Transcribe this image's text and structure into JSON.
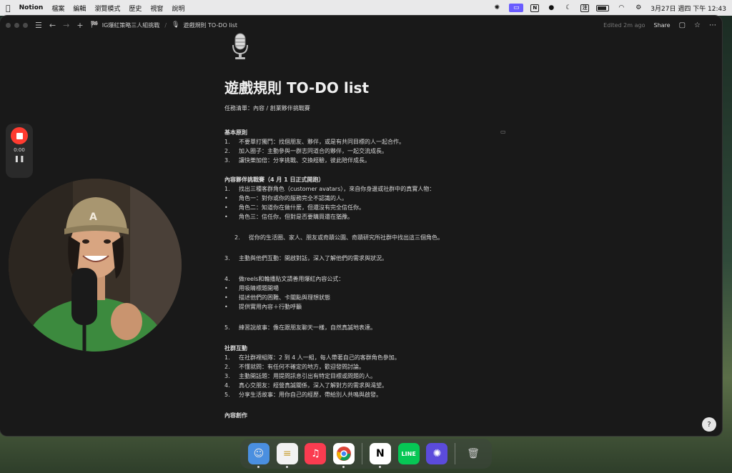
{
  "menubar": {
    "apple_icon": "apple-icon",
    "app_name": "Notion",
    "menus": [
      "檔案",
      "編輯",
      "瀏覽模式",
      "歷史",
      "視窗",
      "說明"
    ],
    "datetime": "3月27日 週四 下午 12:43"
  },
  "topbar": {
    "breadcrumb_parent": "IG爆紅策略三人組挑戰",
    "breadcrumb_current": "遊戲規則 TO-DO list",
    "edited": "Edited 2m ago",
    "share": "Share"
  },
  "page": {
    "title": "遊戲規則 TO-DO list",
    "subtitle": "任務清單：內容 / 創業夥伴挑戰賽",
    "sections": [
      {
        "heading": "基本原則",
        "lines": [
          {
            "marker": "1.",
            "text": "不要單打獨鬥：找個朋友、夥伴，或是有共同目標的人一起合作。"
          },
          {
            "marker": "2.",
            "text": "加入圈子：主動參與一群志同道合的夥伴，一起交流成長。"
          },
          {
            "marker": "3.",
            "text": "讓快樂加倍：分享挑戰、交換經驗，彼此陪伴成長。"
          }
        ]
      },
      {
        "heading": "內容夥伴挑戰賽（4 月 1 日正式開跑）",
        "lines": [
          {
            "marker": "1.",
            "text": "找出三種客群角色（customer avatars），來自你身邊或社群中的真實人物："
          },
          {
            "marker": "•",
            "text": "角色一：對你或你的服務完全不認識的人。"
          },
          {
            "marker": "•",
            "text": "角色二：知道你在做什麼，但還沒有完全信任你。"
          },
          {
            "marker": "•",
            "text": "角色三：信任你，但對是否要購買還在猶豫。"
          }
        ]
      }
    ],
    "item2": {
      "marker": "2.",
      "text": "從你的生活圈、家人、朋友或奇蹟公園、奇蹟研究所社群中找出這三個角色。"
    },
    "item3": {
      "marker": "3.",
      "text": "主動與他們互動：開啟對話，深入了解他們的需求與狀況。"
    },
    "item4": {
      "marker": "4.",
      "text": "做reels和輪播貼文請善用爆紅內容公式："
    },
    "item4_bullets": [
      "用吸睛標題開場",
      "描述他們的困難、卡關點與理想狀態",
      "提供實用內容＋行動呼籲"
    ],
    "item5": {
      "marker": "5.",
      "text": "練習說故事：像在跟朋友聊天一樣，自然真誠地表達。"
    },
    "social": {
      "heading": "社群互動",
      "lines": [
        {
          "marker": "1.",
          "text": "在社群裡組隊：2 到 4 人一組，每人帶著自己的客群角色參加。"
        },
        {
          "marker": "2.",
          "text": "不懂就問：有任何不確定的地方，歡迎發問討論。"
        },
        {
          "marker": "3.",
          "text": "主動開話題：用提問訊息引出有特定目標或問題的人。"
        },
        {
          "marker": "4.",
          "text": "真心交朋友：經營真誠關係，深入了解對方的需求與渴望。"
        },
        {
          "marker": "5.",
          "text": "分享生活故事：用你自己的經歷，帶給別人共鳴與啟發。"
        }
      ]
    },
    "creation_heading": "內容創作"
  },
  "recorder": {
    "time": "0:00"
  },
  "dock": [
    "finder",
    "notes",
    "music",
    "chrome",
    "notion",
    "line",
    "app",
    "trash"
  ]
}
